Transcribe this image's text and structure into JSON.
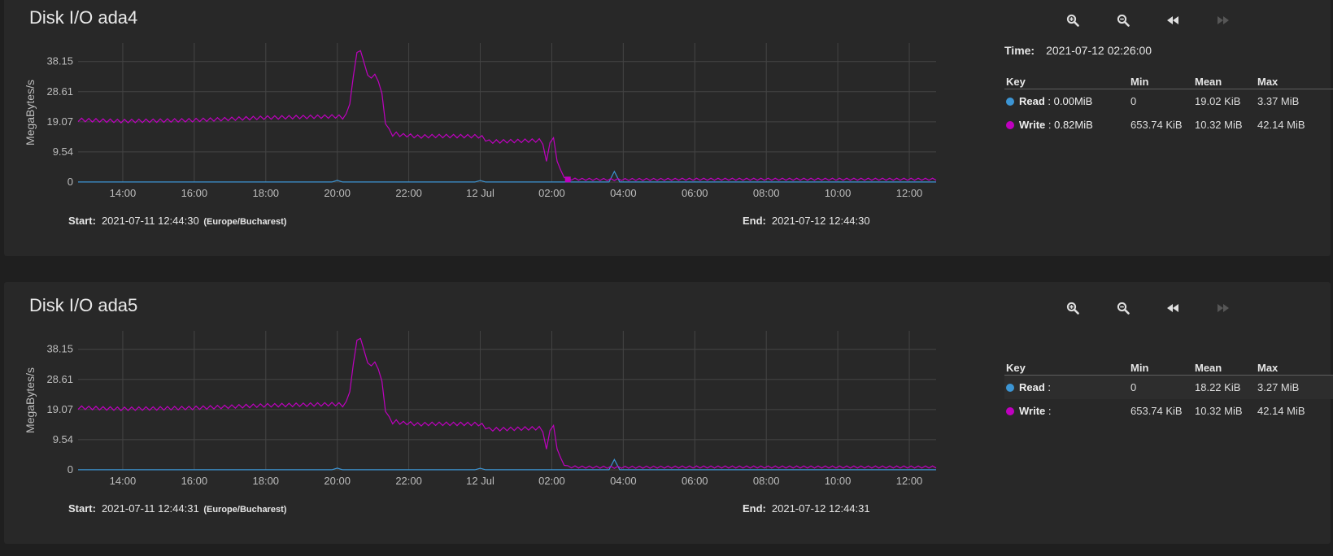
{
  "colors": {
    "read": "#3c95d4",
    "write": "#bf00bf",
    "grid": "#444444",
    "axis_text": "#bdbdbd"
  },
  "controls": {
    "zoom_in_icon": "zoom-in-icon",
    "zoom_out_icon": "zoom-out-icon",
    "back_icon": "rewind-icon",
    "forward_icon": "fast-forward-icon"
  },
  "panels": [
    {
      "title": "Disk I/O ada4",
      "time_label": "Time:",
      "time_value": "2021-07-12 02:26:00",
      "start_label": "Start:",
      "start_value": "2021-07-11 12:44:30",
      "timezone": "(Europe/Bucharest)",
      "end_label": "End:",
      "end_value": "2021-07-12 12:44:30",
      "legend": {
        "headers": {
          "key": "Key",
          "min": "Min",
          "mean": "Mean",
          "max": "Max"
        },
        "rows": [
          {
            "name": "Read",
            "value": ": 0.00MiB",
            "min": "0",
            "mean": "19.02 KiB",
            "max": "3.37 MiB",
            "color": "#3c95d4"
          },
          {
            "name": "Write",
            "value": ": 0.82MiB",
            "min": "653.74 KiB",
            "mean": "10.32 MiB",
            "max": "42.14 MiB",
            "color": "#bf00bf"
          }
        ]
      }
    },
    {
      "title": "Disk I/O ada5",
      "start_label": "Start:",
      "start_value": "2021-07-11 12:44:31",
      "timezone": "(Europe/Bucharest)",
      "end_label": "End:",
      "end_value": "2021-07-12 12:44:31",
      "legend": {
        "headers": {
          "key": "Key",
          "min": "Min",
          "mean": "Mean",
          "max": "Max"
        },
        "rows": [
          {
            "name": "Read",
            "value": ":",
            "min": "0",
            "mean": "18.22 KiB",
            "max": "3.27 MiB",
            "color": "#3c95d4"
          },
          {
            "name": "Write",
            "value": ":",
            "min": "653.74 KiB",
            "mean": "10.32 MiB",
            "max": "42.14 MiB",
            "color": "#bf00bf"
          }
        ]
      }
    }
  ],
  "chart_data": [
    {
      "type": "line",
      "title": "Disk I/O ada4",
      "ylabel": "MegaBytes/s",
      "xlabel": "",
      "ylim": [
        0,
        44
      ],
      "yticks": [
        "0",
        "9.54",
        "19.07",
        "28.61",
        "38.15"
      ],
      "xticks": [
        "14:00",
        "16:00",
        "18:00",
        "20:00",
        "22:00",
        "12 Jul",
        "02:00",
        "04:00",
        "06:00",
        "08:00",
        "10:00",
        "12:00"
      ],
      "grid": true,
      "x_unit": "hours since 12:44:30",
      "series": [
        {
          "name": "Write",
          "color": "#bf00bf",
          "x": [
            0,
            1.25,
            3.25,
            5.25,
            7.25,
            7.4,
            7.55,
            7.7,
            7.8,
            7.95,
            8.1,
            8.3,
            8.45,
            8.6,
            8.75,
            8.9,
            9.05,
            9.25,
            9.5,
            10.0,
            11.25,
            11.5,
            12.25,
            12.9,
            13.0,
            13.1,
            13.2,
            13.3,
            13.45,
            13.65,
            14.0,
            15.0,
            17.0,
            19.0,
            21.0,
            23.0,
            24.0
          ],
          "y": [
            19.7,
            19.3,
            19.6,
            20.4,
            20.8,
            20.5,
            21.4,
            33.0,
            41.6,
            40.8,
            33.3,
            33.6,
            31.8,
            19.0,
            15.0,
            15.3,
            14.8,
            14.8,
            14.4,
            14.6,
            14.5,
            12.8,
            13.0,
            13.2,
            12.5,
            6.0,
            13.0,
            13.5,
            4.0,
            1.0,
            0.9,
            0.8,
            0.9,
            0.9,
            0.9,
            0.9,
            0.9
          ]
        },
        {
          "name": "Read",
          "color": "#3c95d4",
          "x": [
            0,
            7.1,
            7.25,
            7.4,
            11.1,
            11.25,
            11.4,
            14.85,
            15.0,
            15.15,
            24.0
          ],
          "y": [
            0.02,
            0.02,
            0.55,
            0.02,
            0.02,
            0.5,
            0.02,
            0.02,
            3.37,
            0.02,
            0.02
          ]
        }
      ],
      "highlight": {
        "series": "Write",
        "x": 13.7,
        "y": 0.82
      }
    },
    {
      "type": "line",
      "title": "Disk I/O ada5",
      "ylabel": "MegaBytes/s",
      "xlabel": "",
      "ylim": [
        0,
        44
      ],
      "yticks": [
        "0",
        "9.54",
        "19.07",
        "28.61",
        "38.15"
      ],
      "xticks": [
        "14:00",
        "16:00",
        "18:00",
        "20:00",
        "22:00",
        "12 Jul",
        "02:00",
        "04:00",
        "06:00",
        "08:00",
        "10:00",
        "12:00"
      ],
      "grid": true,
      "x_unit": "hours since 12:44:31",
      "series": [
        {
          "name": "Write",
          "color": "#bf00bf",
          "x": [
            0,
            1.25,
            3.25,
            5.25,
            7.25,
            7.4,
            7.55,
            7.7,
            7.8,
            7.95,
            8.1,
            8.3,
            8.45,
            8.6,
            8.75,
            8.9,
            9.05,
            9.25,
            9.5,
            10.0,
            11.25,
            11.5,
            12.25,
            12.9,
            13.0,
            13.1,
            13.2,
            13.3,
            13.45,
            13.65,
            14.0,
            15.0,
            17.0,
            19.0,
            21.0,
            23.0,
            24.0
          ],
          "y": [
            19.7,
            19.3,
            19.6,
            20.4,
            20.8,
            20.5,
            21.4,
            33.0,
            41.6,
            40.8,
            33.3,
            33.6,
            31.8,
            19.0,
            15.0,
            15.3,
            14.8,
            14.8,
            14.4,
            14.6,
            14.5,
            12.8,
            13.0,
            13.2,
            12.5,
            6.0,
            13.0,
            13.5,
            4.0,
            1.0,
            0.9,
            0.8,
            0.9,
            0.9,
            0.9,
            0.9,
            0.9
          ]
        },
        {
          "name": "Read",
          "color": "#3c95d4",
          "x": [
            0,
            7.1,
            7.25,
            7.4,
            11.1,
            11.25,
            11.4,
            14.85,
            15.0,
            15.15,
            24.0
          ],
          "y": [
            0.02,
            0.02,
            0.55,
            0.02,
            0.02,
            0.5,
            0.02,
            0.02,
            3.27,
            0.02,
            0.02
          ]
        }
      ]
    }
  ]
}
